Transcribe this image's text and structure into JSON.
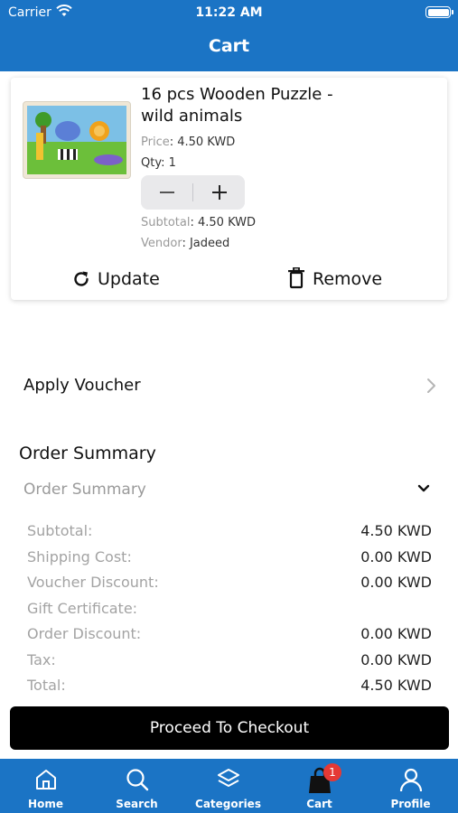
{
  "status": {
    "carrier": "Carrier",
    "time": "11:22 AM"
  },
  "header": {
    "title": "Cart"
  },
  "cart": {
    "item": {
      "name_line1": "16 pcs Wooden Puzzle -",
      "name_line2": "wild animals",
      "price_label": "Price",
      "price_value": ": 4.50 KWD",
      "qty_label": "Qty: 1",
      "subtotal_label": "Subtotal",
      "subtotal_value": ": 4.50 KWD",
      "vendor_label": "Vendor",
      "vendor_value": ": Jadeed",
      "update_label": "Update",
      "remove_label": "Remove"
    }
  },
  "voucher": {
    "label": "Apply Voucher"
  },
  "summary": {
    "title": "Order Summary",
    "toggle_label": "Order Summary",
    "rows": [
      {
        "label": "Subtotal:",
        "value": "4.50 KWD"
      },
      {
        "label": "Shipping Cost:",
        "value": "0.00 KWD"
      },
      {
        "label": "Voucher Discount:",
        "value": "0.00 KWD"
      },
      {
        "label": "Gift Certificate:",
        "value": ""
      },
      {
        "label": "Order Discount:",
        "value": "0.00 KWD"
      },
      {
        "label": "Tax:",
        "value": "0.00 KWD"
      },
      {
        "label": "Total:",
        "value": "4.50 KWD"
      }
    ]
  },
  "checkout": {
    "label": "Proceed To Checkout"
  },
  "tabs": [
    {
      "label": "Home",
      "icon": "home-icon"
    },
    {
      "label": "Search",
      "icon": "search-icon"
    },
    {
      "label": "Categories",
      "icon": "layers-icon"
    },
    {
      "label": "Cart",
      "icon": "shopping-bag-icon",
      "badge": "1"
    },
    {
      "label": "Profile",
      "icon": "user-icon"
    }
  ],
  "colors": {
    "brand": "#1b74c5",
    "badge": "#e53935",
    "checkout": "#000000"
  }
}
